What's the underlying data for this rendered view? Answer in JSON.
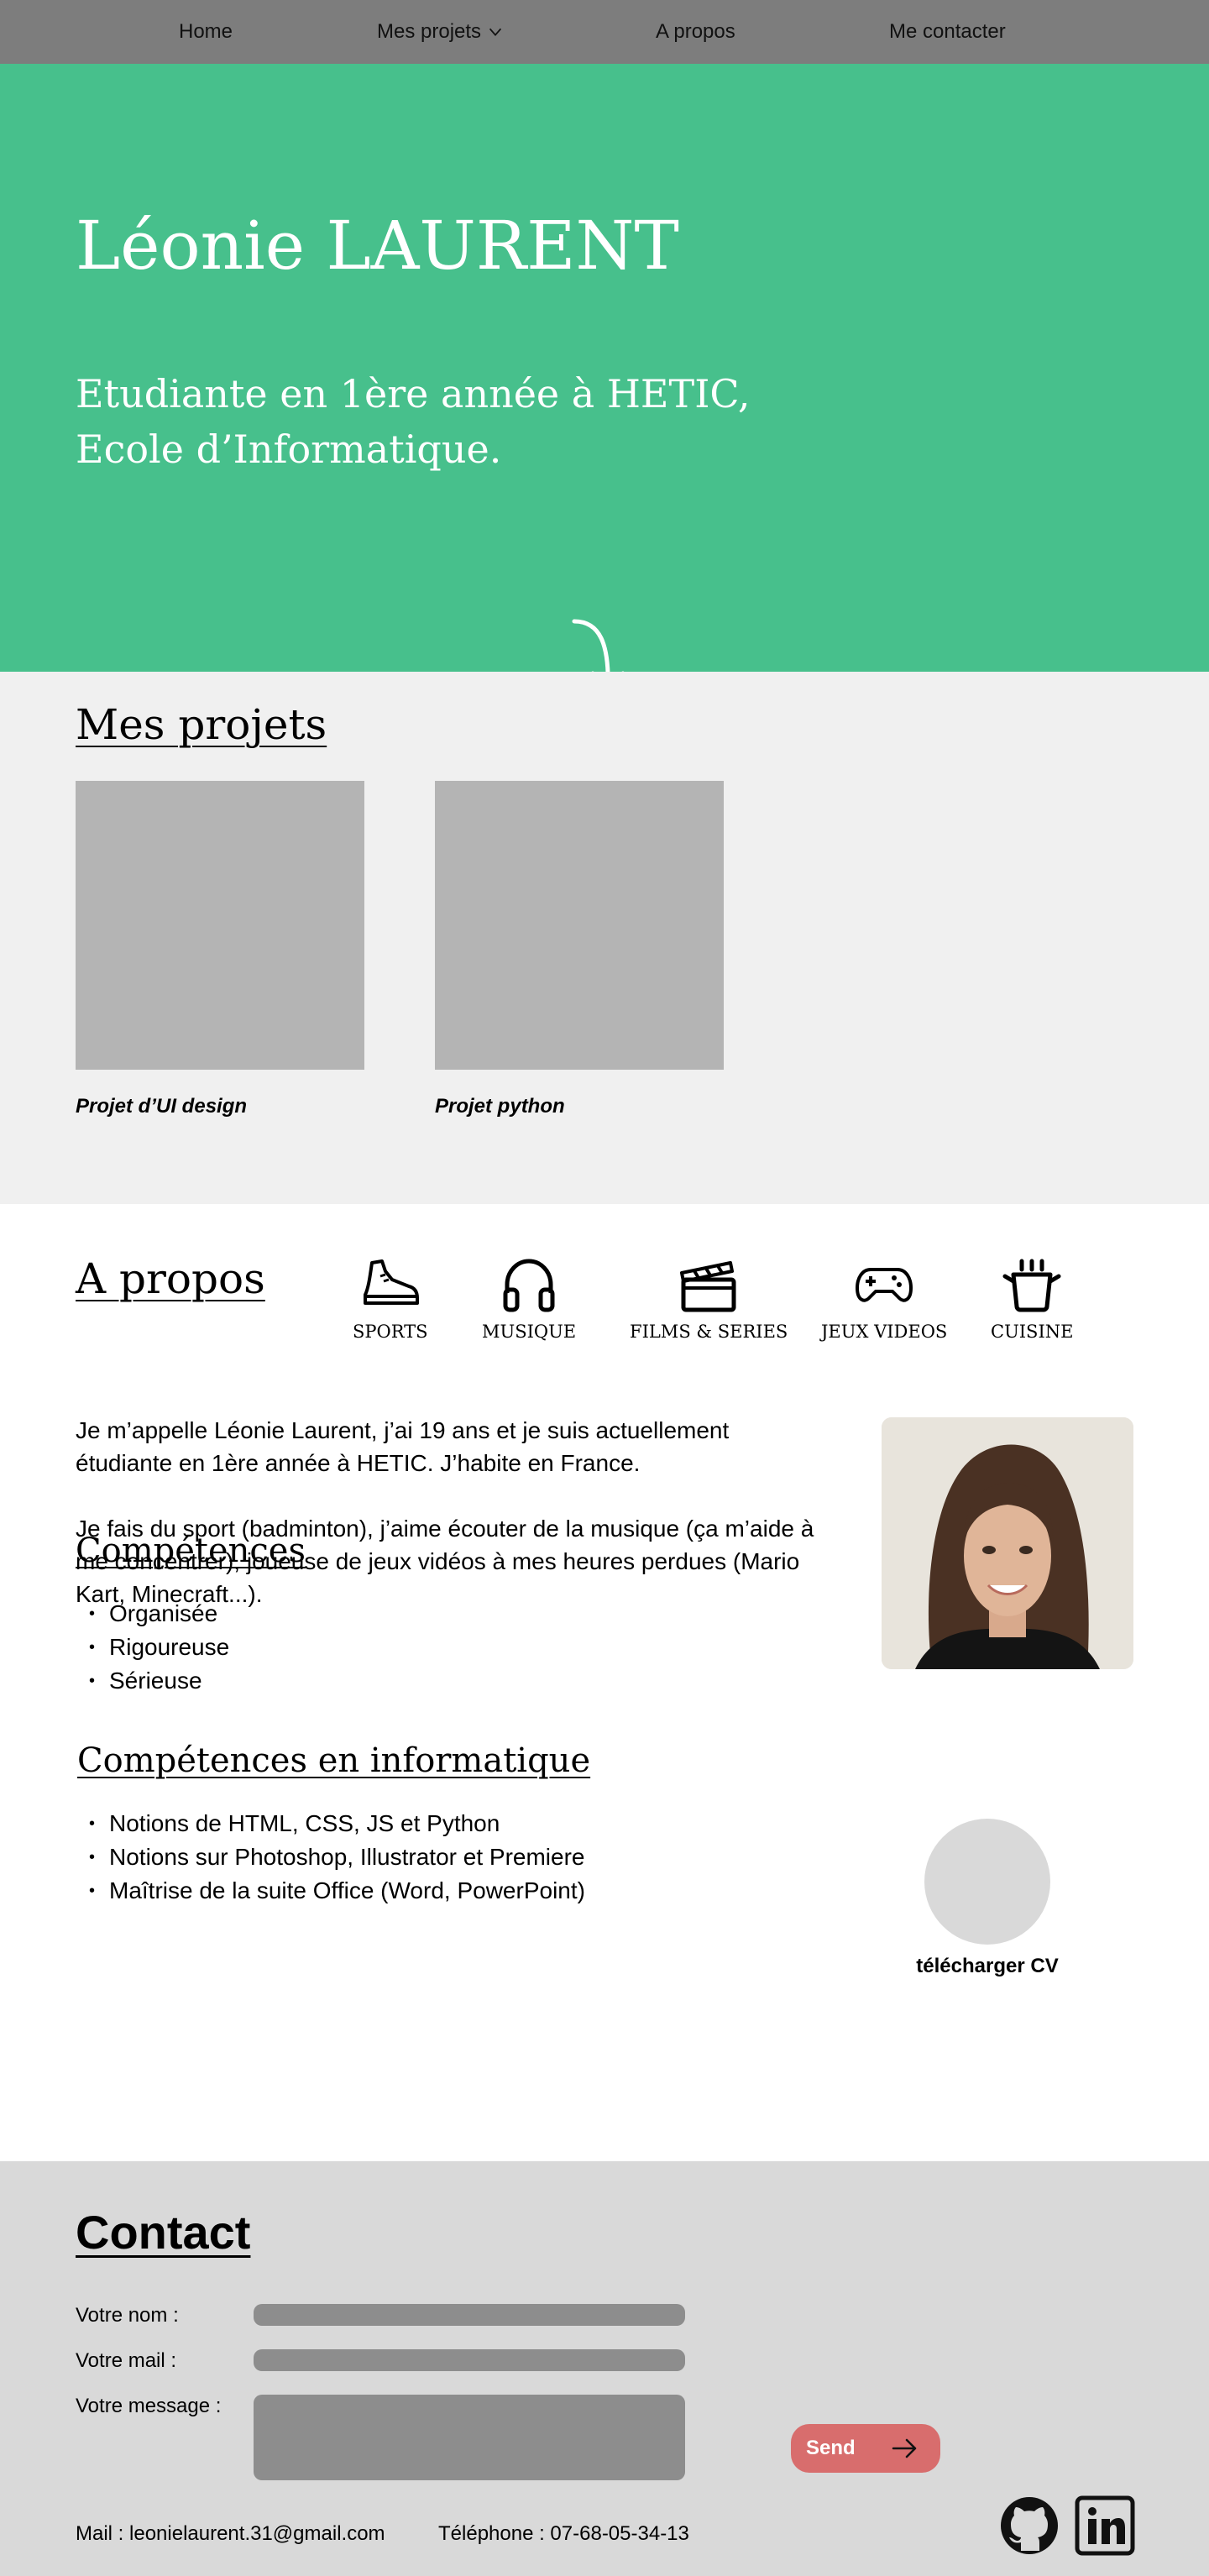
{
  "nav": {
    "home": "Home",
    "projects": "Mes projets",
    "about": "A propos",
    "contact": "Me contacter"
  },
  "hero": {
    "name": "Léonie LAURENT",
    "tagline_line1": "Etudiante en 1ère année à HETIC,",
    "tagline_line2": "Ecole d’Informatique."
  },
  "projects": {
    "title": "Mes projets",
    "items": [
      {
        "caption": "Projet d’UI design"
      },
      {
        "caption": "Projet python"
      }
    ]
  },
  "about": {
    "title": "A propos",
    "hobbies": [
      {
        "label": "SPORTS",
        "icon": "sneaker-icon"
      },
      {
        "label": "MUSIQUE",
        "icon": "headphones-icon"
      },
      {
        "label": "FILMS & SERIES",
        "icon": "clapperboard-icon"
      },
      {
        "label": "JEUX VIDEOS",
        "icon": "gamepad-icon"
      },
      {
        "label": "CUISINE",
        "icon": "cooking-pot-icon"
      }
    ],
    "bio_p1": "Je m’appelle Léonie Laurent, j’ai 19 ans et je suis actuellement étudiante en 1ère année à HETIC. J’habite en France.",
    "bio_p2": "Je fais du sport (badminton), j’aime écouter de la musique (ça m’aide à me concentrer), joueuse de jeux vidéos à mes heures perdues (Mario Kart, Minecraft...).",
    "skills_title": "Compétences",
    "skills": [
      "Organisée",
      "Rigoureuse",
      "Sérieuse"
    ],
    "it_skills_title": "Compétences en informatique",
    "it_skills": [
      "Notions de HTML, CSS, JS et Python",
      "Notions sur Photoshop, Illustrator et Premiere",
      "Maîtrise de la suite Office (Word, PowerPoint)"
    ],
    "cv_label": "télécharger CV"
  },
  "contact": {
    "title": "Contact",
    "name_label": "Votre nom :",
    "mail_label": "Votre mail :",
    "message_label": "Votre message :",
    "name_value": "",
    "mail_value": "",
    "message_value": "",
    "send_label": "Send",
    "email_info": "Mail : leonielaurent.31@gmail.com",
    "phone_info": "Téléphone : 07-68-05-34-13",
    "social": [
      "github-icon",
      "linkedin-icon"
    ]
  },
  "colors": {
    "nav_bg": "#7d7d7d",
    "hero_bg": "#47c08c",
    "projects_bg": "#f0f0f0",
    "contact_bg": "#d9d9d9",
    "send_button": "#d86d6d",
    "field_bg": "#8d8d8d"
  }
}
